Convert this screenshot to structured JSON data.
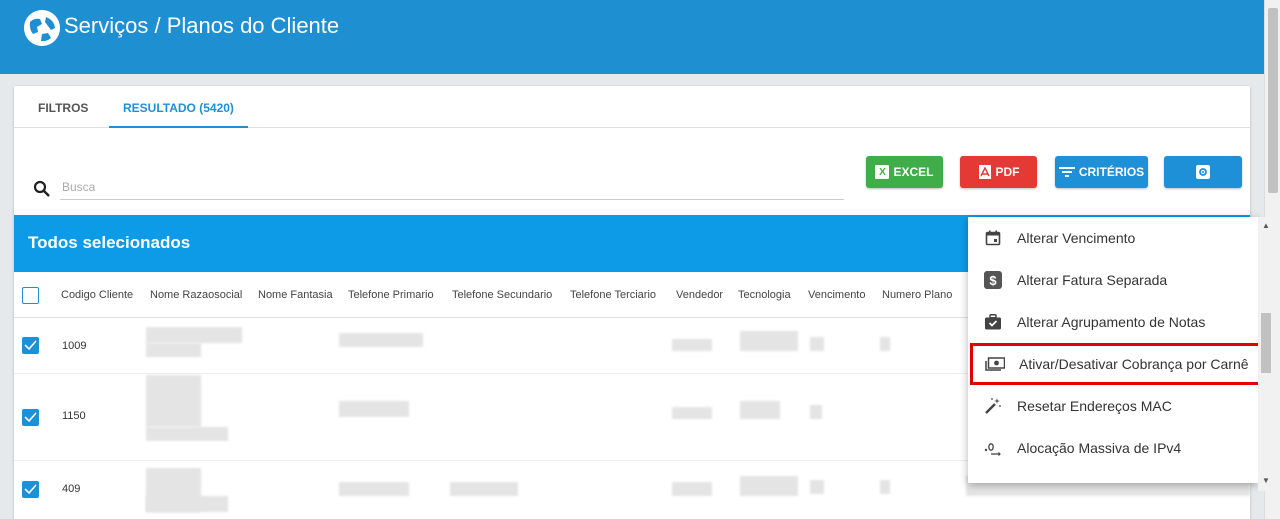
{
  "app": {
    "title": "Serviços / Planos do Cliente"
  },
  "tabs": [
    {
      "label": "FILTROS"
    },
    {
      "label": "RESULTADO (5420)"
    }
  ],
  "search": {
    "placeholder": "Busca",
    "value": ""
  },
  "toolbar": {
    "excel_label": "EXCEL",
    "pdf_label": "PDF",
    "criteria_label": "CRITÉRIOS"
  },
  "banner": {
    "text": "Todos selecionados"
  },
  "table": {
    "columns": [
      "Codigo Cliente",
      "Nome Razaosocial",
      "Nome Fantasia",
      "Telefone Primario",
      "Telefone Secundario",
      "Telefone Terciario",
      "Vendedor",
      "Tecnologia",
      "Vencimento",
      "Numero Plano"
    ],
    "rows": [
      {
        "codigo": "1009"
      },
      {
        "codigo": "1150"
      },
      {
        "codigo": "409"
      }
    ]
  },
  "menu": {
    "items": [
      {
        "label": "Alterar Vencimento",
        "icon": "calendar-icon"
      },
      {
        "label": "Alterar Fatura Separada",
        "icon": "dollar-icon"
      },
      {
        "label": "Alterar Agrupamento de Notas",
        "icon": "briefcase-check-icon"
      },
      {
        "label": "Ativar/Desativar Cobrança por Carnê",
        "icon": "money-icon",
        "highlighted": true
      },
      {
        "label": "Resetar Endereços MAC",
        "icon": "magic-wand-icon"
      },
      {
        "label": "Alocação Massiva de IPv4",
        "icon": "ip-decimal-icon"
      }
    ]
  },
  "colors": {
    "header": "#1e8fd0",
    "accent": "#1e90d8",
    "banner": "#0d9be8",
    "excel": "#3fae49",
    "pdf": "#e53935",
    "highlight": "#e00000"
  }
}
